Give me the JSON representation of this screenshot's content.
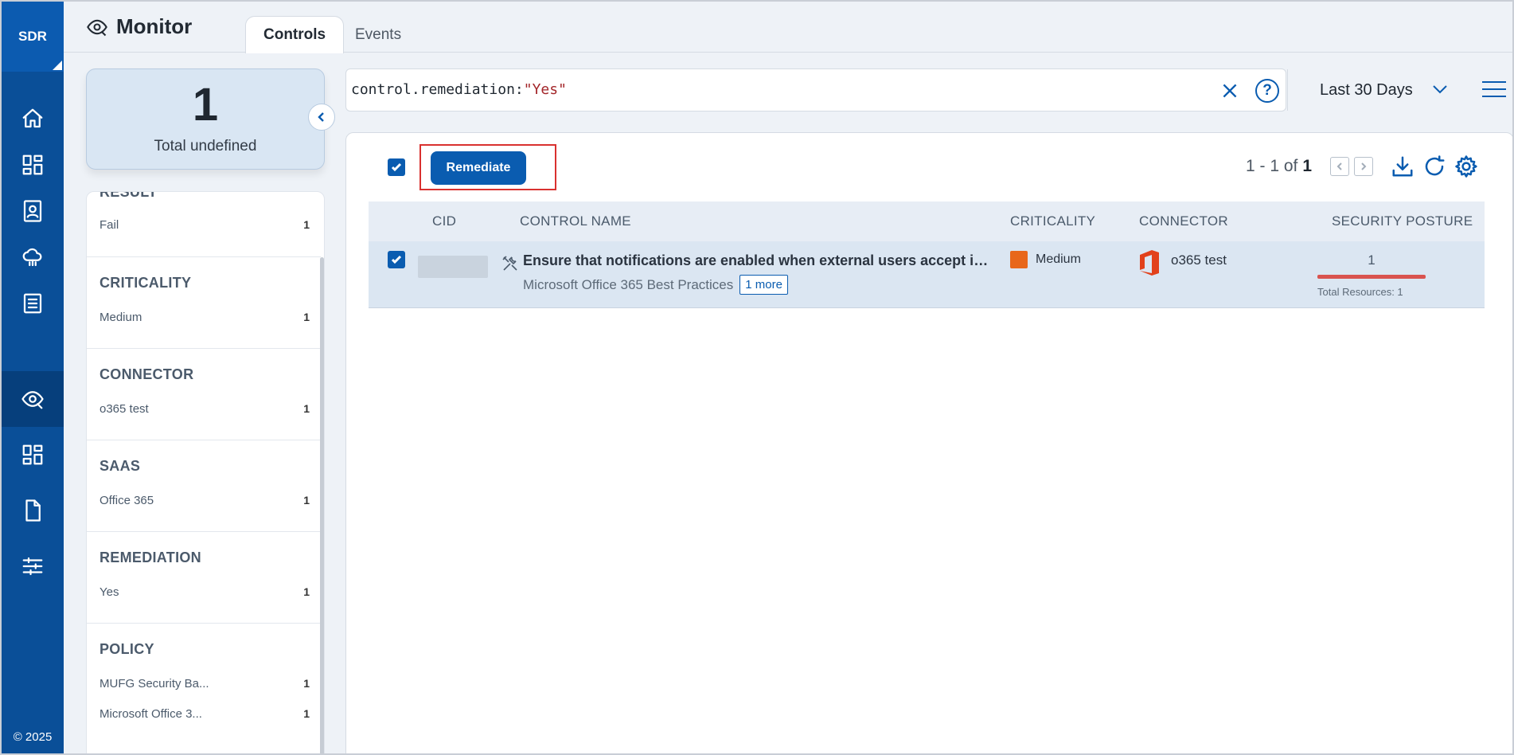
{
  "rail": {
    "logo": "SDR",
    "footer": "© 2025",
    "items": [
      {
        "icon": "home-icon"
      },
      {
        "icon": "dashboard-icon"
      },
      {
        "icon": "contacts-icon"
      },
      {
        "icon": "cloud-icon"
      },
      {
        "icon": "report-icon"
      },
      {
        "icon": "monitor-eye-icon",
        "active": true
      },
      {
        "icon": "dashboard-alt-icon"
      },
      {
        "icon": "document-icon"
      },
      {
        "icon": "sliders-icon"
      }
    ]
  },
  "header": {
    "title": "Monitor",
    "tabs": [
      {
        "label": "Controls",
        "active": true
      },
      {
        "label": "Events",
        "active": false
      }
    ]
  },
  "summary": {
    "count": "1",
    "label": "Total undefined"
  },
  "facets": {
    "result_partial": "RESULT",
    "result_row": {
      "label": "Fail",
      "count": "1"
    },
    "groups": [
      {
        "title": "CRITICALITY",
        "rows": [
          {
            "label": "Medium",
            "count": "1"
          }
        ]
      },
      {
        "title": "CONNECTOR",
        "rows": [
          {
            "label": "o365 test",
            "count": "1"
          }
        ]
      },
      {
        "title": "SAAS",
        "rows": [
          {
            "label": "Office 365",
            "count": "1"
          }
        ]
      },
      {
        "title": "REMEDIATION",
        "rows": [
          {
            "label": "Yes",
            "count": "1"
          }
        ]
      },
      {
        "title": "POLICY",
        "rows": [
          {
            "label": "MUFG Security Ba...",
            "count": "1"
          },
          {
            "label": "Microsoft Office 3...",
            "count": "1"
          }
        ]
      }
    ]
  },
  "search": {
    "query_key": "control.remediation:",
    "query_value": "\"Yes\"",
    "help": "?",
    "range": "Last 30 Days"
  },
  "toolbar": {
    "remediate_label": "Remediate",
    "pager_range": "1 - 1 of",
    "pager_total": "1"
  },
  "table": {
    "columns": [
      "CID",
      "CONTROL NAME",
      "CRITICALITY",
      "CONNECTOR",
      "SECURITY POSTURE"
    ],
    "rows": [
      {
        "control_name": "Ensure that notifications are enabled when external users accept invitations",
        "policy": "Microsoft Office 365 Best Practices",
        "more": "1 more",
        "criticality": "Medium",
        "criticality_color": "#e8671b",
        "connector": "o365 test",
        "posture_count": "1",
        "posture_fill_pct": 100,
        "posture_color": "#d9534f",
        "posture_sub": "Total Resources: 1"
      }
    ]
  },
  "colors": {
    "brand": "#0a5cb0",
    "rail": "#0a4f98"
  }
}
